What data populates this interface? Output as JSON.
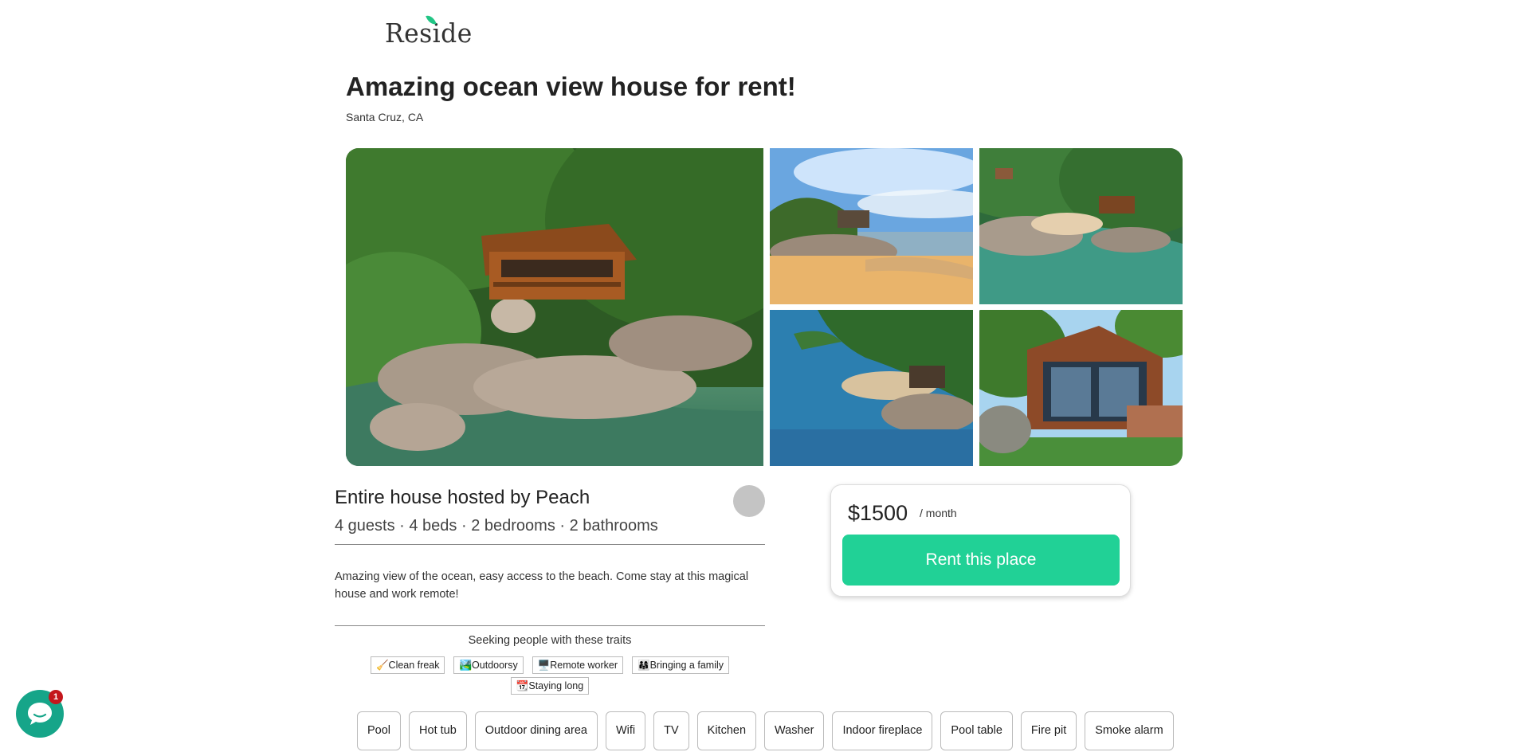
{
  "header": {
    "logo_text": "Reside"
  },
  "listing": {
    "title": "Amazing ocean view house for rent!",
    "location": "Santa Cruz, CA",
    "photos": [
      {
        "alt": "Aerial view of wooden house on rocky shoreline"
      },
      {
        "alt": "Beach with house among rocks under blue sky"
      },
      {
        "alt": "Cove with rocks and house above green water"
      },
      {
        "alt": "Coastline with trees and house by the sea"
      },
      {
        "alt": "Modern wood house with large glass windows"
      }
    ],
    "host_heading": "Entire house hosted by Peach",
    "stats": "4 guests · 4 beds · 2 bedrooms · 2 bathrooms",
    "description": "Amazing view of the ocean, easy access to the beach. Come stay at this magical house and work remote!",
    "traits_heading": "Seeking people with these traits",
    "traits": [
      "🧹Clean freak",
      "🏞️Outdoorsy",
      "🖥️Remote worker",
      "👨‍👩‍👧Bringing a family",
      "📆Staying long"
    ],
    "amenities": [
      "Pool",
      "Hot tub",
      "Outdoor dining area",
      "Wifi",
      "TV",
      "Kitchen",
      "Washer",
      "Indoor fireplace",
      "Pool table",
      "Fire pit",
      "Smoke alarm"
    ]
  },
  "pricing": {
    "price": "$1500",
    "unit": "/ month",
    "cta_label": "Rent this place"
  },
  "chat": {
    "unread_count": "1"
  },
  "colors": {
    "accent": "#21d196",
    "chat": "#16a589",
    "badge": "#c4161c"
  }
}
